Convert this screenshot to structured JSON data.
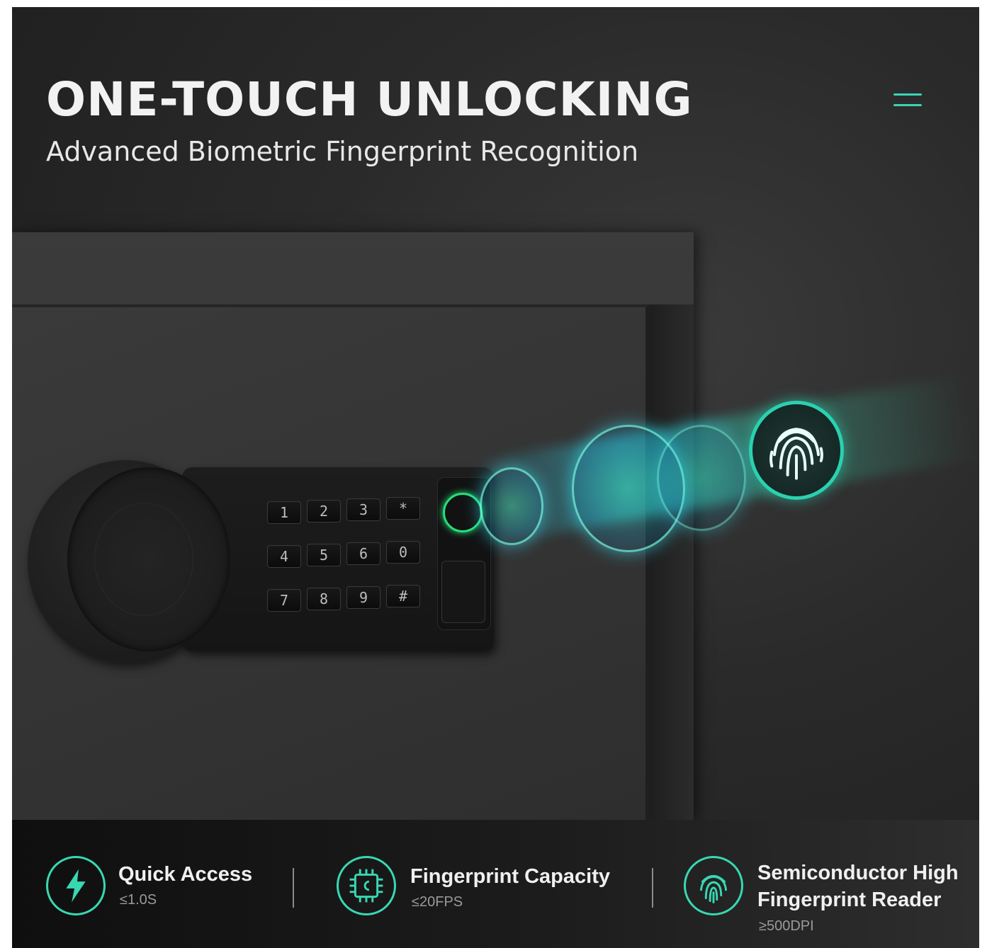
{
  "header": {
    "title": "ONE-TOUCH UNLOCKING",
    "subtitle": "Advanced Biometric Fingerprint Recognition"
  },
  "colors": {
    "accent": "#38d8b2",
    "ring_green": "#25e07a",
    "background": "#2a2a2a"
  },
  "keypad": {
    "keys": [
      "1",
      "2",
      "3",
      "*",
      "4",
      "5",
      "6",
      "0",
      "7",
      "8",
      "9",
      "#"
    ]
  },
  "features": [
    {
      "icon": "lightning-icon",
      "title": "Quick Access",
      "value": "≤1.0S"
    },
    {
      "icon": "chip-icon",
      "title": "Fingerprint Capacity",
      "value": "≤20FPS"
    },
    {
      "icon": "fingerprint-icon",
      "title_line1": "Semiconductor High",
      "title_line2": "Fingerprint Reader",
      "value": "≥500DPI"
    }
  ]
}
